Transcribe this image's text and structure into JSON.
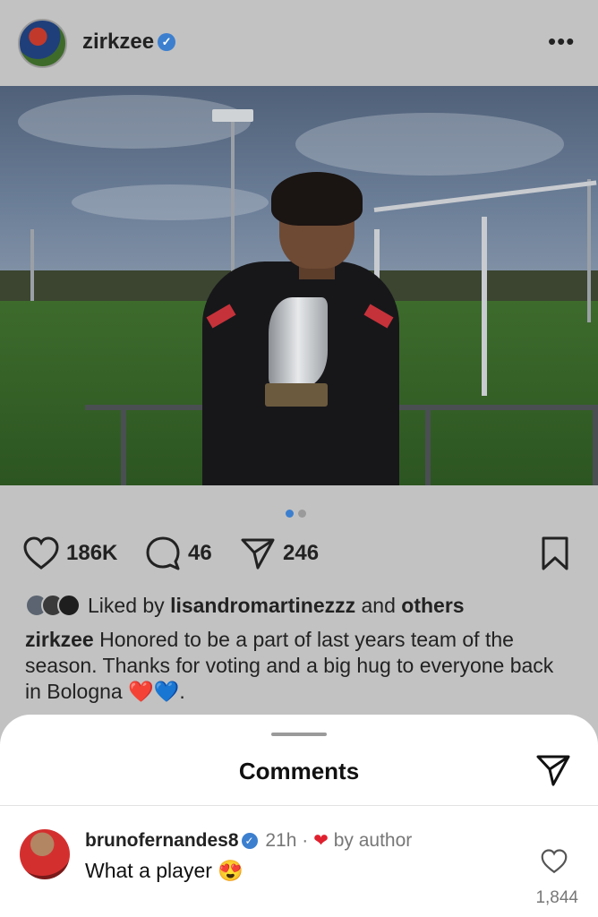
{
  "post": {
    "username": "zirkzee",
    "verified_mark": "✓",
    "more_icon": "more-icon",
    "likes": "186K",
    "comments": "46",
    "shares": "246",
    "liked_by_prefix": "Liked by",
    "liked_by_user": "lisandromartinezzz",
    "liked_by_and": "and",
    "liked_by_others": "others",
    "caption_user": "zirkzee",
    "caption_text": "Honored to be a part of last years team of the season. Thanks for voting and a big hug to everyone back in Bologna",
    "caption_emoji_1": "❤️",
    "caption_emoji_2": "💙",
    "caption_end": ".",
    "carousel": {
      "current": 1,
      "total": 2
    }
  },
  "sheet": {
    "title": "Comments"
  },
  "comments": [
    {
      "username": "brunofernandes8",
      "verified_mark": "✓",
      "time": "21h",
      "separator": "·",
      "author_heart": "❤",
      "author_label": "by author",
      "text": "What a player",
      "emoji": "😍",
      "like_count": "1,844"
    }
  ],
  "colors": {
    "dim_background": "#c2c2c2",
    "verified_blue": "#3c7fcf",
    "active_dot": "#3c7fcf",
    "inactive_dot": "#9a9a9a",
    "author_heart": "#e0202e"
  }
}
